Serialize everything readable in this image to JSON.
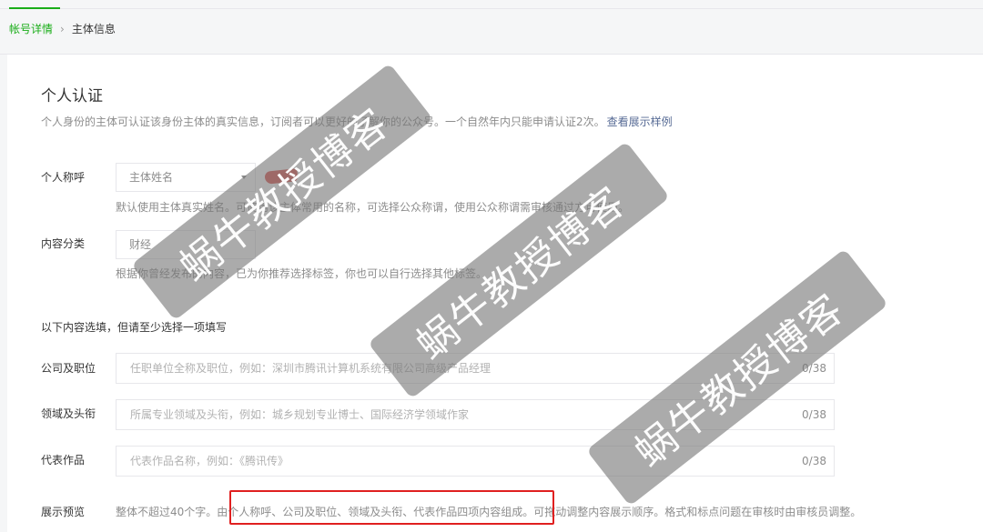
{
  "breadcrumb": {
    "link": "帐号详情",
    "separator": "›",
    "current": "主体信息"
  },
  "section": {
    "title": "个人认证",
    "description": "个人身份的主体可认证该身份主体的真实信息，订阅者可以更好的了解你的公众号。一个自然年内只能申请认证2次。",
    "example_link": "查看展示样例"
  },
  "fields": {
    "personal_title": {
      "label": "个人称呼",
      "value": "主体姓名",
      "hint": "默认使用主体真实姓名。可使用该主体常用的名称，可选择公众称谓，使用公众称谓需审核通过方可使用。"
    },
    "content_category": {
      "label": "内容分类",
      "value": "财经",
      "hint": "根据你曾经发布的内容，已为你推荐选择标签，你也可以自行选择其他标签。"
    }
  },
  "optional_note": "以下内容选填，但请至少选择一项填写",
  "inputs": [
    {
      "label": "公司及职位",
      "placeholder": "任职单位全称及职位，例如：深圳市腾讯计算机系统有限公司高级产品经理",
      "counter": "0/38"
    },
    {
      "label": "领域及头衔",
      "placeholder": "所属专业领域及头衔，例如：城乡规划专业博士、国际经济学领域作家",
      "counter": "0/38"
    },
    {
      "label": "代表作品",
      "placeholder": "代表作品名称，例如：《腾讯传》",
      "counter": "0/38"
    }
  ],
  "preview": {
    "label": "展示预览",
    "text": "整体不超过40个字。由个人称呼、公司及职位、领域及头衔、代表作品四项内容组成。可拖动调整内容展示顺序。格式和标点问题在审核时由审核员调整。"
  },
  "watermark_text": "蜗牛教授博客",
  "colors": {
    "accent": "#1aad19",
    "link": "#576b95",
    "highlight": "#e02020"
  }
}
